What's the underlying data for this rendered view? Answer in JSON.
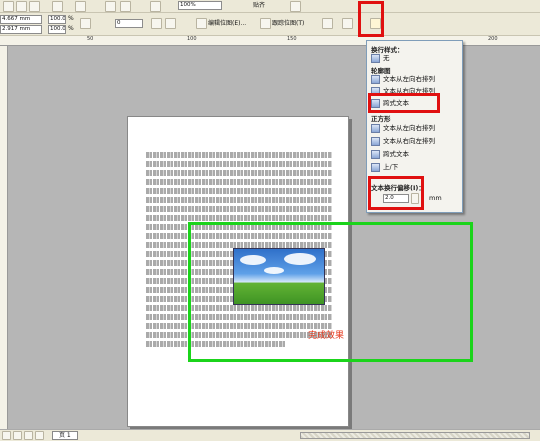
{
  "toolbar": {
    "zoom_value": "100%",
    "snap_label": "贴齐",
    "width_value": "4.667 mm",
    "height_value": "2.917 mm",
    "scale_x": "100.0",
    "scale_y": "100.0",
    "percent_symbol": "%",
    "rotation_value": "0",
    "edit_bitmap_label": "编辑位图(E)...",
    "trace_bitmap_label": "跟踪位图(T)"
  },
  "ruler": {
    "ticks": [
      "50",
      "100",
      "150",
      "200"
    ]
  },
  "popup": {
    "wrap_style_label": "换行样式：",
    "none_label": "无",
    "contour_label": "轮廓图",
    "contour_ltr": "文本从左向右排列",
    "contour_rtl": "文本从右向左排列",
    "straddle_text": "跨式文本",
    "square_label": "正方形",
    "square_ltr": "文本从左向右排列",
    "square_rtl": "文本从右向左排列",
    "square_straddle": "跨式文本",
    "square_topbottom": "上/下",
    "offset_label": "文本换行偏移(I)：",
    "offset_value": "2.0",
    "offset_unit": "mm"
  },
  "canvas": {
    "result_label": "完成效果"
  },
  "status": {
    "page_tab": "页 1"
  }
}
